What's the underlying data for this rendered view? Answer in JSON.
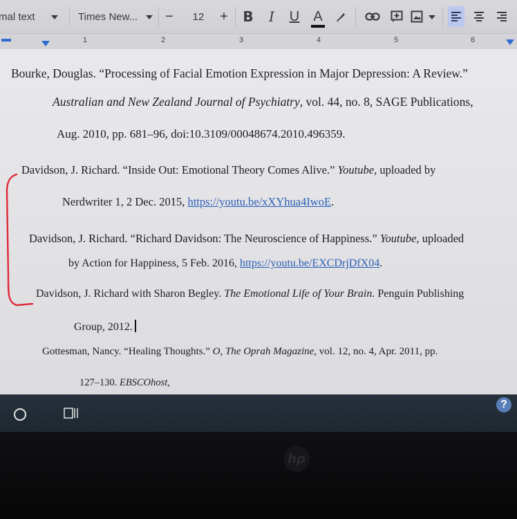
{
  "toolbar": {
    "style": "mal text",
    "font": "Times New...",
    "size_minus": "−",
    "font_size": "12",
    "size_plus": "+",
    "bold": "B",
    "italic": "I",
    "underline": "U",
    "text_color": "A",
    "text_color_value": "#111111",
    "icons": [
      "highlight-icon",
      "link-icon",
      "comment-icon",
      "image-icon",
      "align-left-icon",
      "align-center-icon",
      "align-right-icon"
    ]
  },
  "ruler": {
    "numbers": [
      "1",
      "2",
      "3",
      "4",
      "5",
      "6"
    ]
  },
  "document": {
    "entries": [
      {
        "author": "Bourke, Douglas. ",
        "title": "“Processing of Facial Emotion Expression in Major Depression: A Review.”",
        "journal": "Australian and New Zealand Journal of Psychiatry",
        "rest1": ", vol. 44, no. 8, SAGE Publications,",
        "line3": "Aug. 2010, pp. 681–96, doi:10.3109/00048674.2010.496359."
      },
      {
        "lead": "Davidson, J. Richard. “Inside Out: Emotional Theory Comes Alive.” ",
        "site": "Youtube,",
        "tail": " uploaded by",
        "line2_pre": "Nerdwriter 1, 2 Dec. 2015, ",
        "url": "https://youtu.be/xXYhua4IwoE",
        "line2_post": "."
      },
      {
        "lead": "Davidson, J. Richard. “Richard Davidson: The Neuroscience of Happiness.” ",
        "site": "Youtube,",
        "tail": " uploaded",
        "line2_pre": "by Action for Happiness, 5 Feb. 2016, ",
        "url": "https://youtu.be/EXCDrjDfX04",
        "line2_post": "."
      },
      {
        "lead": "Davidson, J. Richard with Sharon Begley. ",
        "book": "The Emotional Life of Your Brain.",
        "tail": " Penguin Publishing",
        "line2": "Group, 2012."
      },
      {
        "lead": "Gottesman, Nancy. “Healing Thoughts.” ",
        "mag": "O, The Oprah Magazine",
        "tail": ", vol. 12, no. 4, Apr. 2011, pp.",
        "line2_pre": "127–130. ",
        "db": "EBSCOhost,"
      }
    ],
    "annotation_color": "#e0283a"
  },
  "shelf": {
    "help": "?"
  }
}
